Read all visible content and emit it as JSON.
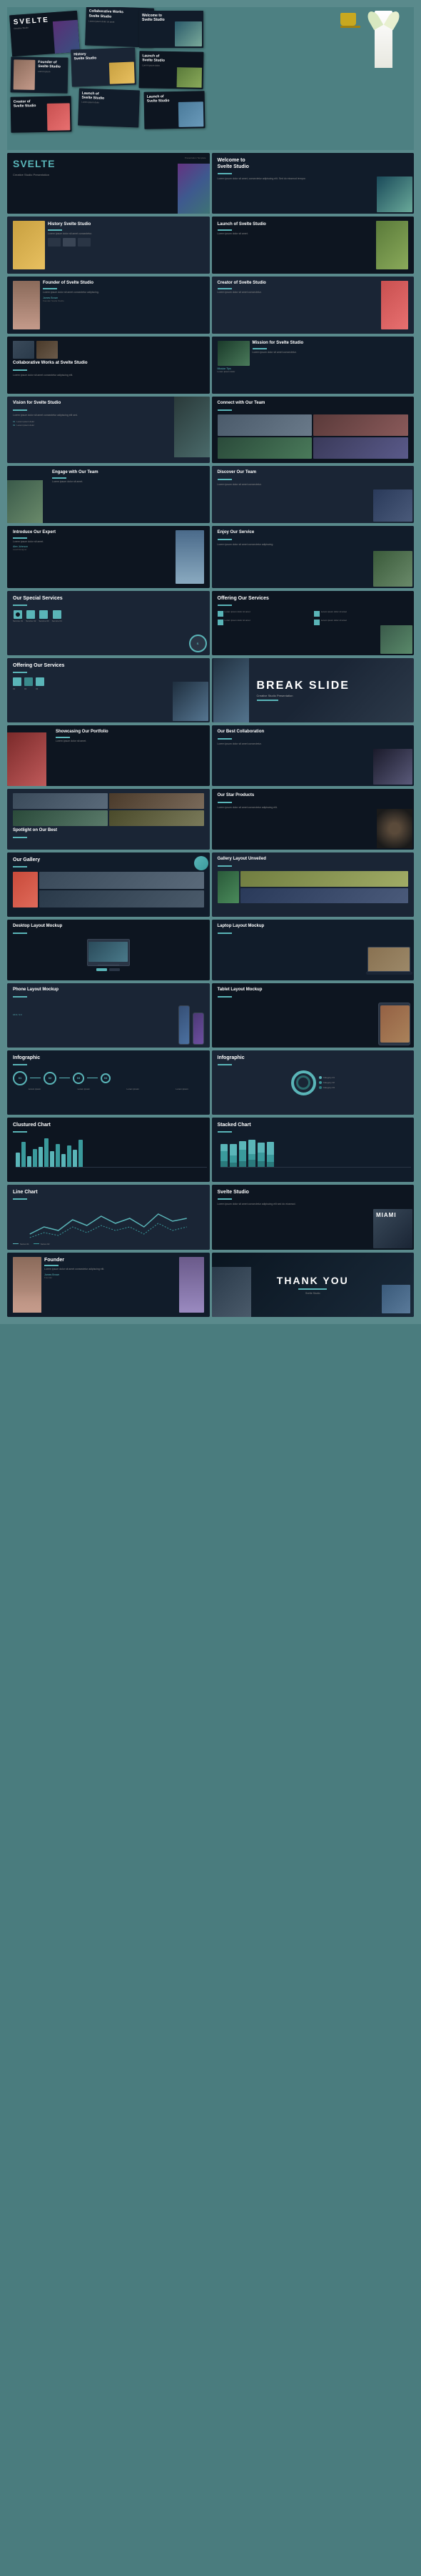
{
  "brand": "SVELTE",
  "tagline": "Svelte Studio",
  "slides": [
    {
      "id": 1,
      "title": "SVELTE",
      "subtitle": "Creative Studio",
      "type": "hero"
    },
    {
      "id": 2,
      "title": "Welcome to Svelte Studio",
      "type": "welcome"
    },
    {
      "id": 3,
      "title": "History Svelte Studio",
      "type": "history"
    },
    {
      "id": 4,
      "title": "Launch of Svelte Studio",
      "type": "launch"
    },
    {
      "id": 5,
      "title": "Founder of Svelte Studio",
      "type": "founder"
    },
    {
      "id": 6,
      "title": "Creator of Svelte Studio",
      "type": "creator"
    },
    {
      "id": 7,
      "title": "Collaborative Works at Svelte Studio",
      "type": "collab"
    },
    {
      "id": 8,
      "title": "Mission for Svelte Studio",
      "type": "mission"
    },
    {
      "id": 9,
      "title": "Vision for Svelte Studio",
      "type": "vision"
    },
    {
      "id": 10,
      "title": "Connect with Our Team",
      "type": "connect"
    },
    {
      "id": 11,
      "title": "Engage with Our Team",
      "type": "engage"
    },
    {
      "id": 12,
      "title": "Discover Our Team",
      "type": "discover"
    },
    {
      "id": 13,
      "title": "Introduce Our Expert",
      "type": "expert"
    },
    {
      "id": 14,
      "title": "Enjoy Our Service",
      "type": "enjoy"
    },
    {
      "id": 15,
      "title": "Our Special Services",
      "type": "services"
    },
    {
      "id": 16,
      "title": "Offering Our Services",
      "type": "offering1"
    },
    {
      "id": 17,
      "title": "Offering Our Services",
      "type": "offering2"
    },
    {
      "id": 18,
      "title": "BREAK SLIDE",
      "type": "break"
    },
    {
      "id": 19,
      "title": "Showcasing Our Portfolio",
      "type": "portfolio"
    },
    {
      "id": 20,
      "title": "Our Best Collaboration",
      "type": "collab2"
    },
    {
      "id": 21,
      "title": "Spotlight on Our Best",
      "type": "spotlight"
    },
    {
      "id": 22,
      "title": "Our Star Products",
      "type": "star"
    },
    {
      "id": 23,
      "title": "Our Gallery",
      "type": "gallery"
    },
    {
      "id": 24,
      "title": "Gallery Layout Unveiled",
      "type": "gallery2"
    },
    {
      "id": 25,
      "title": "Desktop Layout Mockup",
      "type": "desktop"
    },
    {
      "id": 26,
      "title": "Laptop Layout Mockup",
      "type": "laptop"
    },
    {
      "id": 27,
      "title": "Phone Layout Mockup",
      "type": "phone"
    },
    {
      "id": 28,
      "title": "Tablet Layout Mockup",
      "type": "tablet"
    },
    {
      "id": 29,
      "title": "Infographic",
      "type": "infographic1"
    },
    {
      "id": 30,
      "title": "Infographic",
      "type": "infographic2"
    },
    {
      "id": 31,
      "title": "Clustured Chart",
      "type": "clustured"
    },
    {
      "id": 32,
      "title": "Stacked Chart",
      "type": "stacked"
    },
    {
      "id": 33,
      "title": "Line Chart",
      "type": "line"
    },
    {
      "id": 34,
      "title": "Svelte Studio",
      "type": "studio"
    },
    {
      "id": 35,
      "title": "Founder",
      "type": "founder2"
    },
    {
      "id": 36,
      "title": "THANK YOU",
      "type": "thankyou"
    }
  ],
  "colors": {
    "teal": "#5ab5b8",
    "dark": "#0d1520",
    "mid": "#1a2535",
    "accent": "#6bc4a0",
    "bg": "#4d8082"
  },
  "chart": {
    "bars": [
      20,
      35,
      25,
      45,
      30,
      40,
      28,
      38,
      22,
      42,
      32,
      36
    ],
    "stacked_bars": [
      {
        "a": 15,
        "b": 20,
        "c": 10
      },
      {
        "a": 25,
        "b": 15,
        "c": 8
      },
      {
        "a": 18,
        "b": 22,
        "c": 12
      },
      {
        "a": 30,
        "b": 10,
        "c": 15
      },
      {
        "a": 20,
        "b": 18,
        "c": 10
      }
    ]
  }
}
